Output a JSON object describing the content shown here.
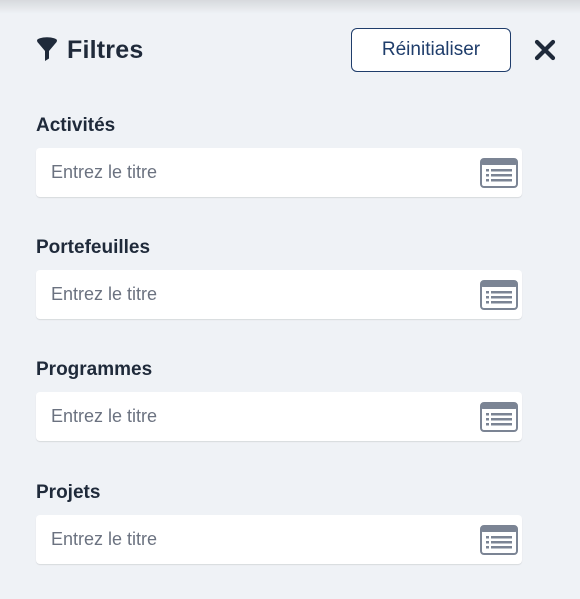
{
  "header": {
    "title": "Filtres",
    "reset_label": "Réinitialiser",
    "filter_icon": "filter-icon",
    "close_icon": "close-icon"
  },
  "sections": [
    {
      "label": "Activités",
      "placeholder": "Entrez le titre",
      "value": ""
    },
    {
      "label": "Portefeuilles",
      "placeholder": "Entrez le titre",
      "value": ""
    },
    {
      "label": "Programmes",
      "placeholder": "Entrez le titre",
      "value": ""
    },
    {
      "label": "Projets",
      "placeholder": "Entrez le titre",
      "value": ""
    }
  ],
  "colors": {
    "background": "#eff2f6",
    "text": "#1f2a3a",
    "accent": "#1f3d6b",
    "icon_gray": "#7b8494"
  }
}
